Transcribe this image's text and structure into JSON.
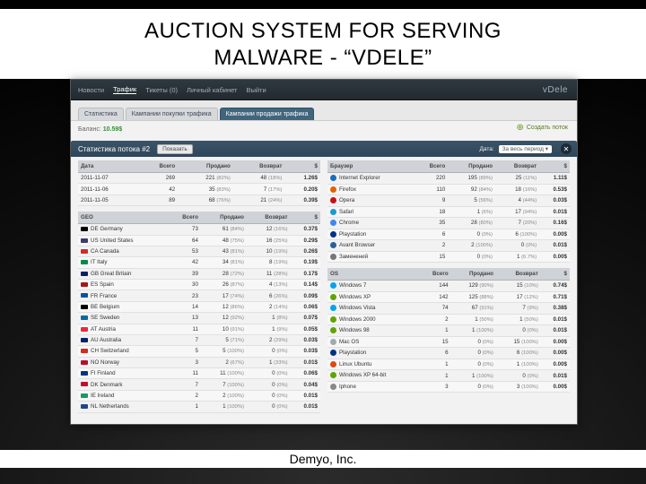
{
  "slide": {
    "title_line1": "AUCTION SYSTEM FOR SERVING",
    "title_line2": "MALWARE -  “VDELE”",
    "footer": "Demyo, Inc."
  },
  "header": {
    "nav": [
      "Новости",
      "Трафик",
      "Тикеты (0)",
      "Личный кабинет",
      "Выйти"
    ],
    "brand": "vDele"
  },
  "tabs": {
    "items": [
      "Статистика",
      "Кампании покупки трафика",
      "Кампании продажи трафика"
    ],
    "active_index": 2,
    "balance_label": "Баланс:",
    "balance_value": "10.59$",
    "create_label": "Создать поток"
  },
  "stats": {
    "title": "Статистика потока #2",
    "show_btn": "Показать",
    "date_label": "Дата:",
    "date_value": "За весь период ▾"
  },
  "columns_main": [
    "Дата",
    "Всего",
    "Продано",
    "Возврат",
    "$"
  ],
  "columns_geo": [
    "GEO",
    "Всего",
    "Продано",
    "Возврат",
    "$"
  ],
  "columns_browser": [
    "Браузер",
    "Всего",
    "Продано",
    "Возврат",
    "$"
  ],
  "columns_os": [
    "OS",
    "Всего",
    "Продано",
    "Возврат",
    "$"
  ],
  "dates": [
    {
      "d": "2011-11-07",
      "all": "269",
      "sold": "221 (82%)",
      "ret": "48 (18%)",
      "usd": "1.26$"
    },
    {
      "d": "2011-11-06",
      "all": "42",
      "sold": "35 (83%)",
      "ret": "7 (17%)",
      "usd": "0.20$"
    },
    {
      "d": "2011-11-05",
      "all": "89",
      "sold": "68 (76%)",
      "ret": "21 (24%)",
      "usd": "0.39$"
    }
  ],
  "geo": [
    {
      "n": "DE Germany",
      "c": "#000",
      "all": "73",
      "sold": "61 (84%)",
      "ret": "12 (16%)",
      "usd": "0.37$"
    },
    {
      "n": "US United States",
      "c": "#3c3b6e",
      "all": "64",
      "sold": "48 (75%)",
      "ret": "16 (25%)",
      "usd": "0.29$"
    },
    {
      "n": "CA Canada",
      "c": "#d52b1e",
      "all": "53",
      "sold": "43 (81%)",
      "ret": "10 (19%)",
      "usd": "0.26$"
    },
    {
      "n": "IT Italy",
      "c": "#008c45",
      "all": "42",
      "sold": "34 (81%)",
      "ret": "8 (19%)",
      "usd": "0.19$"
    },
    {
      "n": "GB Great Britain",
      "c": "#012169",
      "all": "39",
      "sold": "28 (72%)",
      "ret": "11 (28%)",
      "usd": "0.17$"
    },
    {
      "n": "ES Spain",
      "c": "#aa151b",
      "all": "30",
      "sold": "26 (87%)",
      "ret": "4 (13%)",
      "usd": "0.14$"
    },
    {
      "n": "FR France",
      "c": "#0055a4",
      "all": "23",
      "sold": "17 (74%)",
      "ret": "6 (26%)",
      "usd": "0.09$"
    },
    {
      "n": "BE Belgium",
      "c": "#000",
      "all": "14",
      "sold": "12 (86%)",
      "ret": "2 (14%)",
      "usd": "0.06$"
    },
    {
      "n": "SE Sweden",
      "c": "#006aa7",
      "all": "13",
      "sold": "12 (92%)",
      "ret": "1 (8%)",
      "usd": "0.07$"
    },
    {
      "n": "AT Austria",
      "c": "#ed2939",
      "all": "11",
      "sold": "10 (91%)",
      "ret": "1 (9%)",
      "usd": "0.05$"
    },
    {
      "n": "AU Australia",
      "c": "#012169",
      "all": "7",
      "sold": "5 (71%)",
      "ret": "2 (29%)",
      "usd": "0.03$"
    },
    {
      "n": "CH Switzerland",
      "c": "#d52b1e",
      "all": "5",
      "sold": "5 (100%)",
      "ret": "0 (0%)",
      "usd": "0.03$"
    },
    {
      "n": "NO Norway",
      "c": "#ba0c2f",
      "all": "3",
      "sold": "2 (67%)",
      "ret": "1 (33%)",
      "usd": "0.01$"
    },
    {
      "n": "FI Finland",
      "c": "#003580",
      "all": "11",
      "sold": "11 (100%)",
      "ret": "0 (0%)",
      "usd": "0.06$"
    },
    {
      "n": "DK Denmark",
      "c": "#c60c30",
      "all": "7",
      "sold": "7 (100%)",
      "ret": "0 (0%)",
      "usd": "0.04$"
    },
    {
      "n": "IE Ireland",
      "c": "#169b62",
      "all": "2",
      "sold": "2 (100%)",
      "ret": "0 (0%)",
      "usd": "0.01$"
    },
    {
      "n": "NL Netherlands",
      "c": "#21468b",
      "all": "1",
      "sold": "1 (100%)",
      "ret": "0 (0%)",
      "usd": "0.01$"
    }
  ],
  "browser": [
    {
      "n": "Internet Explorer",
      "c": "#1e6bb8",
      "all": "220",
      "sold": "195 (89%)",
      "ret": "25 (11%)",
      "usd": "1.11$"
    },
    {
      "n": "Firefox",
      "c": "#e66000",
      "all": "110",
      "sold": "92 (84%)",
      "ret": "18 (16%)",
      "usd": "0.53$"
    },
    {
      "n": "Opera",
      "c": "#cc0f16",
      "all": "9",
      "sold": "5 (56%)",
      "ret": "4 (44%)",
      "usd": "0.03$"
    },
    {
      "n": "Safari",
      "c": "#1a9ad6",
      "all": "18",
      "sold": "1 (6%)",
      "ret": "17 (94%)",
      "usd": "0.01$"
    },
    {
      "n": "Chrome",
      "c": "#4285f4",
      "all": "35",
      "sold": "28 (80%)",
      "ret": "7 (20%)",
      "usd": "0.16$"
    },
    {
      "n": "Playstation",
      "c": "#003087",
      "all": "6",
      "sold": "0 (0%)",
      "ret": "6 (100%)",
      "usd": "0.00$"
    },
    {
      "n": "Avant Browser",
      "c": "#2a6099",
      "all": "2",
      "sold": "2 (100%)",
      "ret": "0 (0%)",
      "usd": "0.01$"
    },
    {
      "n": "Заменений",
      "c": "#777",
      "all": "15",
      "sold": "0 (0%)",
      "ret": "1 (6.7%)",
      "usd": "0.00$"
    }
  ],
  "os": [
    {
      "n": "Windows 7",
      "c": "#00a4ef",
      "all": "144",
      "sold": "129 (90%)",
      "ret": "15 (10%)",
      "usd": "0.74$"
    },
    {
      "n": "Windows XP",
      "c": "#5ea500",
      "all": "142",
      "sold": "125 (88%)",
      "ret": "17 (12%)",
      "usd": "0.71$"
    },
    {
      "n": "Windows Vista",
      "c": "#00a4ef",
      "all": "74",
      "sold": "67 (91%)",
      "ret": "7 (9%)",
      "usd": "0.38$"
    },
    {
      "n": "Windows 2000",
      "c": "#5ea500",
      "all": "2",
      "sold": "1 (50%)",
      "ret": "1 (50%)",
      "usd": "0.01$"
    },
    {
      "n": "Windows 98",
      "c": "#5ea500",
      "all": "1",
      "sold": "1 (100%)",
      "ret": "0 (0%)",
      "usd": "0.01$"
    },
    {
      "n": "Mac OS",
      "c": "#a2aaad",
      "all": "15",
      "sold": "0 (0%)",
      "ret": "15 (100%)",
      "usd": "0.00$"
    },
    {
      "n": "Playstation",
      "c": "#003087",
      "all": "6",
      "sold": "0 (0%)",
      "ret": "6 (100%)",
      "usd": "0.00$"
    },
    {
      "n": "Linux Ubuntu",
      "c": "#dd4814",
      "all": "1",
      "sold": "0 (0%)",
      "ret": "1 (100%)",
      "usd": "0.00$"
    },
    {
      "n": "Windows XP 64-bit",
      "c": "#5ea500",
      "all": "1",
      "sold": "1 (100%)",
      "ret": "0 (0%)",
      "usd": "0.01$"
    },
    {
      "n": "Iphone",
      "c": "#888",
      "all": "3",
      "sold": "0 (0%)",
      "ret": "3 (100%)",
      "usd": "0.00$"
    }
  ]
}
